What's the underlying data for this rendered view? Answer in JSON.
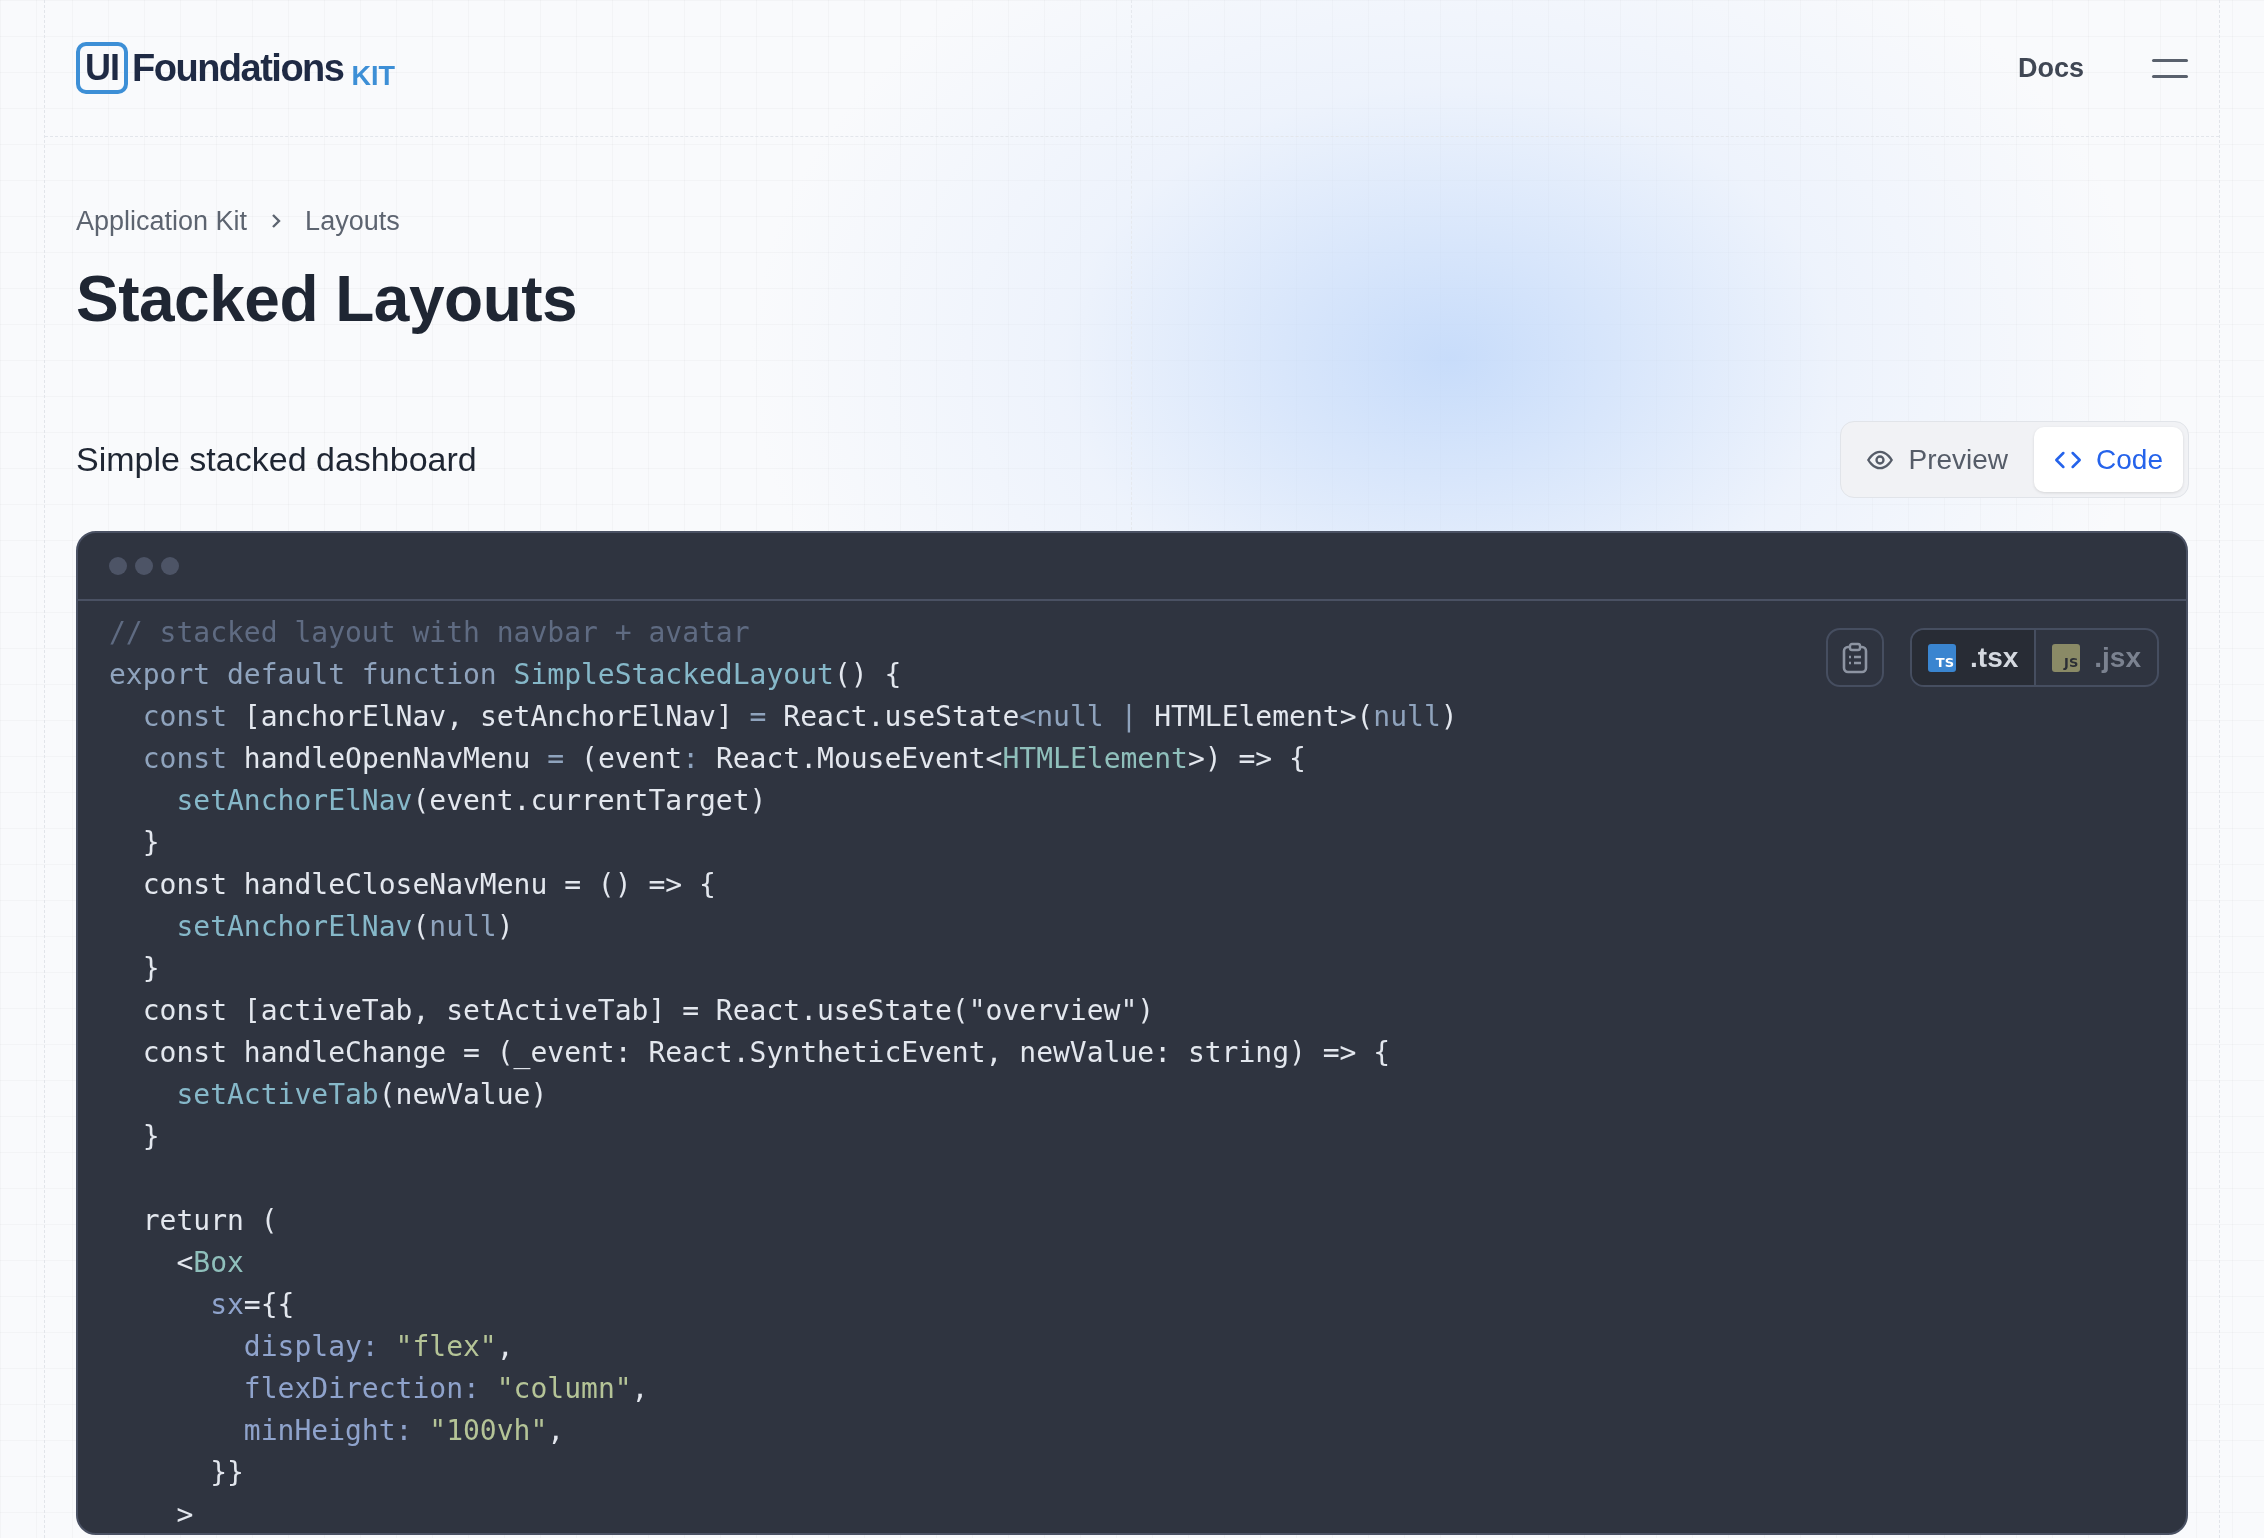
{
  "header": {
    "logo": {
      "mark": "UI",
      "name": "Foundations",
      "suffix": "KIT"
    },
    "nav_link": "Docs"
  },
  "breadcrumb": [
    "Application Kit",
    "Layouts"
  ],
  "page_title": "Stacked Layouts",
  "section": {
    "title": "Simple stacked dashboard",
    "view_tabs": [
      {
        "label": "Preview",
        "selected": false
      },
      {
        "label": "Code",
        "selected": true
      }
    ],
    "file_tabs": [
      {
        "badge": "TS",
        "label": ".tsx",
        "selected": true
      },
      {
        "badge": "JS",
        "label": ".jsx",
        "selected": false
      }
    ],
    "code_lines": [
      {
        "kind": "code",
        "tokens": [
          {
            "kind": "comment",
            "text": "// stacked layout with navbar + avatar"
          }
        ]
      },
      {
        "kind": "code",
        "tokens": [
          {
            "kind": "keyword",
            "text": "export default function "
          },
          {
            "kind": "func",
            "text": "SimpleStackedLayout"
          },
          {
            "kind": "plain",
            "text": "() {"
          }
        ]
      },
      {
        "kind": "code",
        "tokens": [
          {
            "kind": "keyword",
            "text": "  const"
          },
          {
            "kind": "plain",
            "text": " [anchorElNav, setAnchorElNav] "
          },
          {
            "kind": "keyword",
            "text": "="
          },
          {
            "kind": "plain",
            "text": " React.useState"
          },
          {
            "kind": "keyword",
            "text": "<null | "
          },
          {
            "kind": "plain",
            "text": "HTMLElement>("
          },
          {
            "kind": "keyword",
            "text": "null"
          },
          {
            "kind": "plain",
            "text": ")"
          }
        ]
      },
      {
        "kind": "code",
        "tokens": [
          {
            "kind": "keyword",
            "text": "  const"
          },
          {
            "kind": "plain",
            "text": " handleOpenNavMenu "
          },
          {
            "kind": "keyword",
            "text": "="
          },
          {
            "kind": "plain",
            "text": " (event"
          },
          {
            "kind": "keyword",
            "text": ":"
          },
          {
            "kind": "plain",
            "text": " React.MouseEvent<"
          },
          {
            "kind": "type",
            "text": "HTMLElement"
          },
          {
            "kind": "plain",
            "text": ">) => {"
          }
        ]
      },
      {
        "kind": "code",
        "tokens": [
          {
            "kind": "func",
            "text": "    setAnchorElNav"
          },
          {
            "kind": "plain",
            "text": "(event.currentTarget)"
          }
        ]
      },
      {
        "kind": "code",
        "tokens": [
          {
            "kind": "plain",
            "text": "  }"
          }
        ]
      },
      {
        "kind": "code",
        "tokens": [
          {
            "kind": "plain",
            "text": "  const handleCloseNavMenu = () => {"
          }
        ]
      },
      {
        "kind": "code",
        "tokens": [
          {
            "kind": "func",
            "text": "    setAnchorElNav"
          },
          {
            "kind": "plain",
            "text": "("
          },
          {
            "kind": "keyword",
            "text": "null"
          },
          {
            "kind": "plain",
            "text": ")"
          }
        ]
      },
      {
        "kind": "code",
        "tokens": [
          {
            "kind": "plain",
            "text": "  }"
          }
        ]
      },
      {
        "kind": "code",
        "tokens": [
          {
            "kind": "plain",
            "text": "  const [activeTab, setActiveTab] = React.useState(\"overview\")"
          }
        ]
      },
      {
        "kind": "code",
        "tokens": [
          {
            "kind": "plain",
            "text": "  const handleChange = (_event: React.SyntheticEvent, newValue: string) => {"
          }
        ]
      },
      {
        "kind": "code",
        "tokens": [
          {
            "kind": "func",
            "text": "    setActiveTab"
          },
          {
            "kind": "plain",
            "text": "(newValue)"
          }
        ]
      },
      {
        "kind": "code",
        "tokens": [
          {
            "kind": "plain",
            "text": "  }"
          }
        ]
      },
      {
        "kind": "blank"
      },
      {
        "kind": "code",
        "tokens": [
          {
            "kind": "plain",
            "text": "  return ("
          }
        ]
      },
      {
        "kind": "code",
        "tokens": [
          {
            "kind": "plain",
            "text": "    <"
          },
          {
            "kind": "type",
            "text": "Box"
          }
        ]
      },
      {
        "kind": "code",
        "tokens": [
          {
            "kind": "prop",
            "text": "      sx"
          },
          {
            "kind": "plain",
            "text": "={{"
          }
        ]
      },
      {
        "kind": "code",
        "tokens": [
          {
            "kind": "prop",
            "text": "        display: "
          },
          {
            "kind": "string",
            "text": "\"flex\""
          },
          {
            "kind": "plain",
            "text": ","
          }
        ]
      },
      {
        "kind": "code",
        "tokens": [
          {
            "kind": "prop",
            "text": "        flexDirection: "
          },
          {
            "kind": "string",
            "text": "\"column\""
          },
          {
            "kind": "plain",
            "text": ","
          }
        ]
      },
      {
        "kind": "code",
        "tokens": [
          {
            "kind": "prop",
            "text": "        minHeight: "
          },
          {
            "kind": "string",
            "text": "\"100vh\""
          },
          {
            "kind": "plain",
            "text": ","
          }
        ]
      },
      {
        "kind": "code",
        "tokens": [
          {
            "kind": "plain",
            "text": "      }}"
          }
        ]
      },
      {
        "kind": "code",
        "tokens": [
          {
            "kind": "plain",
            "text": "    >"
          }
        ]
      }
    ]
  }
}
